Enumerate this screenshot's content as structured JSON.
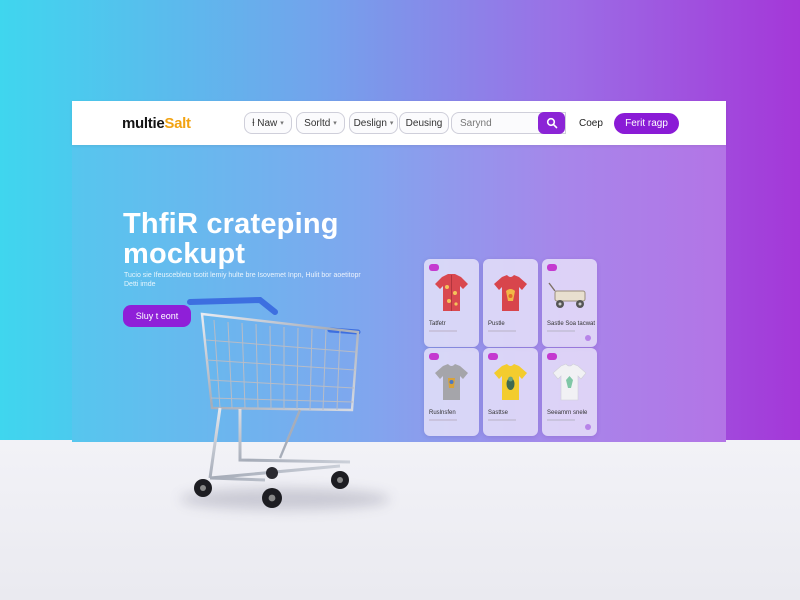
{
  "header": {
    "logo_main": "multie",
    "logo_accent": "Salt",
    "menu": [
      {
        "label": "ƚ Naw"
      },
      {
        "label": "Sorltd"
      },
      {
        "label": "Deslign"
      }
    ],
    "menu_plain": "Deusing",
    "search_placeholder": "Sarynd",
    "nav_link": "Coep",
    "cta_label": "Ferit ragp"
  },
  "hero": {
    "title_line1": "ThfiR crateping",
    "title_line2": "mockupt",
    "subtitle": "Tucio sie Ifeuscebleto tsotit lemiy hulte bre Isovemet Inpn, Hulit bor aoetitopr Detti imde",
    "cta_label": "Sluy t eont"
  },
  "products": [
    {
      "name": "Tatfetr",
      "icon": "red-floral-shirt-icon"
    },
    {
      "name": "Pustle",
      "icon": "red-tshirt-icon"
    },
    {
      "name": "Sastle Soa tacwat",
      "icon": "toy-wagon-icon"
    },
    {
      "name": "Ruslnsfen",
      "icon": "gray-tshirt-icon"
    },
    {
      "name": "Sasttse",
      "icon": "yellow-tshirt-icon"
    },
    {
      "name": "Seeamrn snele",
      "icon": "white-tshirt-icon"
    }
  ],
  "colors": {
    "accent": "#8a1bd6",
    "logo_accent": "#f2a312"
  }
}
